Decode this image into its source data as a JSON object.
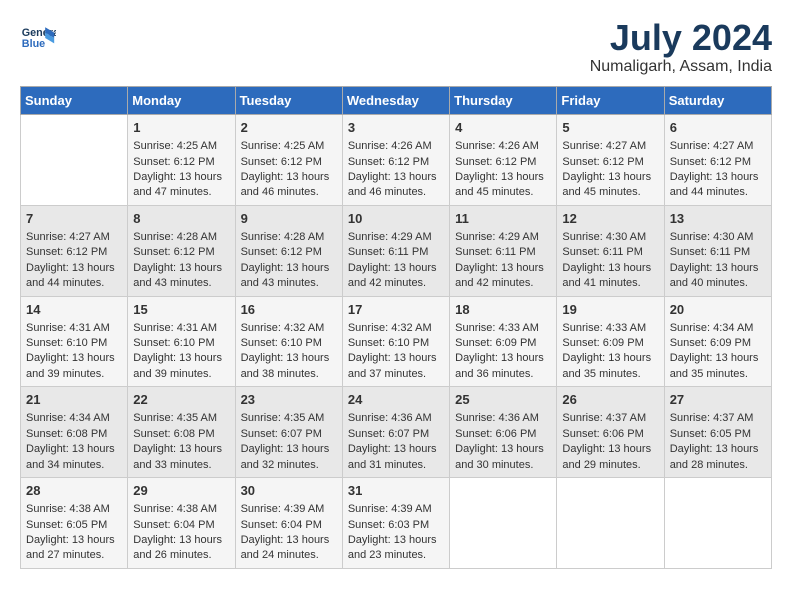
{
  "header": {
    "logo_line1": "General",
    "logo_line2": "Blue",
    "month_year": "July 2024",
    "location": "Numaligarh, Assam, India"
  },
  "weekdays": [
    "Sunday",
    "Monday",
    "Tuesday",
    "Wednesday",
    "Thursday",
    "Friday",
    "Saturday"
  ],
  "weeks": [
    [
      {
        "day": "",
        "info": ""
      },
      {
        "day": "1",
        "info": "Sunrise: 4:25 AM\nSunset: 6:12 PM\nDaylight: 13 hours\nand 47 minutes."
      },
      {
        "day": "2",
        "info": "Sunrise: 4:25 AM\nSunset: 6:12 PM\nDaylight: 13 hours\nand 46 minutes."
      },
      {
        "day": "3",
        "info": "Sunrise: 4:26 AM\nSunset: 6:12 PM\nDaylight: 13 hours\nand 46 minutes."
      },
      {
        "day": "4",
        "info": "Sunrise: 4:26 AM\nSunset: 6:12 PM\nDaylight: 13 hours\nand 45 minutes."
      },
      {
        "day": "5",
        "info": "Sunrise: 4:27 AM\nSunset: 6:12 PM\nDaylight: 13 hours\nand 45 minutes."
      },
      {
        "day": "6",
        "info": "Sunrise: 4:27 AM\nSunset: 6:12 PM\nDaylight: 13 hours\nand 44 minutes."
      }
    ],
    [
      {
        "day": "7",
        "info": "Sunrise: 4:27 AM\nSunset: 6:12 PM\nDaylight: 13 hours\nand 44 minutes."
      },
      {
        "day": "8",
        "info": "Sunrise: 4:28 AM\nSunset: 6:12 PM\nDaylight: 13 hours\nand 43 minutes."
      },
      {
        "day": "9",
        "info": "Sunrise: 4:28 AM\nSunset: 6:12 PM\nDaylight: 13 hours\nand 43 minutes."
      },
      {
        "day": "10",
        "info": "Sunrise: 4:29 AM\nSunset: 6:11 PM\nDaylight: 13 hours\nand 42 minutes."
      },
      {
        "day": "11",
        "info": "Sunrise: 4:29 AM\nSunset: 6:11 PM\nDaylight: 13 hours\nand 42 minutes."
      },
      {
        "day": "12",
        "info": "Sunrise: 4:30 AM\nSunset: 6:11 PM\nDaylight: 13 hours\nand 41 minutes."
      },
      {
        "day": "13",
        "info": "Sunrise: 4:30 AM\nSunset: 6:11 PM\nDaylight: 13 hours\nand 40 minutes."
      }
    ],
    [
      {
        "day": "14",
        "info": "Sunrise: 4:31 AM\nSunset: 6:10 PM\nDaylight: 13 hours\nand 39 minutes."
      },
      {
        "day": "15",
        "info": "Sunrise: 4:31 AM\nSunset: 6:10 PM\nDaylight: 13 hours\nand 39 minutes."
      },
      {
        "day": "16",
        "info": "Sunrise: 4:32 AM\nSunset: 6:10 PM\nDaylight: 13 hours\nand 38 minutes."
      },
      {
        "day": "17",
        "info": "Sunrise: 4:32 AM\nSunset: 6:10 PM\nDaylight: 13 hours\nand 37 minutes."
      },
      {
        "day": "18",
        "info": "Sunrise: 4:33 AM\nSunset: 6:09 PM\nDaylight: 13 hours\nand 36 minutes."
      },
      {
        "day": "19",
        "info": "Sunrise: 4:33 AM\nSunset: 6:09 PM\nDaylight: 13 hours\nand 35 minutes."
      },
      {
        "day": "20",
        "info": "Sunrise: 4:34 AM\nSunset: 6:09 PM\nDaylight: 13 hours\nand 35 minutes."
      }
    ],
    [
      {
        "day": "21",
        "info": "Sunrise: 4:34 AM\nSunset: 6:08 PM\nDaylight: 13 hours\nand 34 minutes."
      },
      {
        "day": "22",
        "info": "Sunrise: 4:35 AM\nSunset: 6:08 PM\nDaylight: 13 hours\nand 33 minutes."
      },
      {
        "day": "23",
        "info": "Sunrise: 4:35 AM\nSunset: 6:07 PM\nDaylight: 13 hours\nand 32 minutes."
      },
      {
        "day": "24",
        "info": "Sunrise: 4:36 AM\nSunset: 6:07 PM\nDaylight: 13 hours\nand 31 minutes."
      },
      {
        "day": "25",
        "info": "Sunrise: 4:36 AM\nSunset: 6:06 PM\nDaylight: 13 hours\nand 30 minutes."
      },
      {
        "day": "26",
        "info": "Sunrise: 4:37 AM\nSunset: 6:06 PM\nDaylight: 13 hours\nand 29 minutes."
      },
      {
        "day": "27",
        "info": "Sunrise: 4:37 AM\nSunset: 6:05 PM\nDaylight: 13 hours\nand 28 minutes."
      }
    ],
    [
      {
        "day": "28",
        "info": "Sunrise: 4:38 AM\nSunset: 6:05 PM\nDaylight: 13 hours\nand 27 minutes."
      },
      {
        "day": "29",
        "info": "Sunrise: 4:38 AM\nSunset: 6:04 PM\nDaylight: 13 hours\nand 26 minutes."
      },
      {
        "day": "30",
        "info": "Sunrise: 4:39 AM\nSunset: 6:04 PM\nDaylight: 13 hours\nand 24 minutes."
      },
      {
        "day": "31",
        "info": "Sunrise: 4:39 AM\nSunset: 6:03 PM\nDaylight: 13 hours\nand 23 minutes."
      },
      {
        "day": "",
        "info": ""
      },
      {
        "day": "",
        "info": ""
      },
      {
        "day": "",
        "info": ""
      }
    ]
  ]
}
